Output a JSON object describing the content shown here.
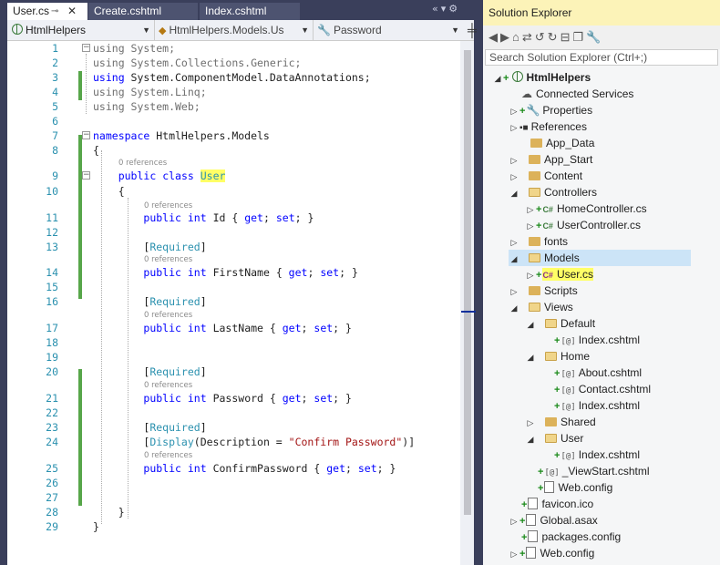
{
  "editor": {
    "tabs": [
      {
        "label": "User.cs",
        "active": true
      },
      {
        "label": "Create.cshtml",
        "active": false
      },
      {
        "label": "Index.cshtml",
        "active": false
      }
    ],
    "navbar": {
      "project": "HtmlHelpers",
      "type": "HtmlHelpers.Models.Us",
      "member": "Password"
    },
    "references_label": "0 references"
  },
  "solution_explorer": {
    "title": "Solution Explorer",
    "search_placeholder": "Search Solution Explorer (Ctrl+;)",
    "nodes": [
      {
        "label": "HtmlHelpers",
        "icon": "project-icon"
      },
      {
        "label": "Connected Services",
        "icon": "connected-services-icon"
      },
      {
        "label": "Properties",
        "icon": "wrench-icon"
      },
      {
        "label": "References",
        "icon": "references-icon"
      },
      {
        "label": "App_Data",
        "icon": "folder-icon"
      },
      {
        "label": "App_Start",
        "icon": "folder-icon"
      },
      {
        "label": "Content",
        "icon": "folder-icon"
      },
      {
        "label": "Controllers",
        "icon": "folder-open-icon"
      },
      {
        "label": "HomeController.cs",
        "icon": "csharp-file-icon"
      },
      {
        "label": "UserController.cs",
        "icon": "csharp-file-icon"
      },
      {
        "label": "fonts",
        "icon": "folder-icon"
      },
      {
        "label": "Models",
        "icon": "folder-open-icon"
      },
      {
        "label": "User.cs",
        "icon": "csharp-file-icon"
      },
      {
        "label": "Scripts",
        "icon": "folder-icon"
      },
      {
        "label": "Views",
        "icon": "folder-open-icon"
      },
      {
        "label": "Default",
        "icon": "folder-open-icon"
      },
      {
        "label": "Index.cshtml",
        "icon": "razor-file-icon"
      },
      {
        "label": "Home",
        "icon": "folder-open-icon"
      },
      {
        "label": "About.cshtml",
        "icon": "razor-file-icon"
      },
      {
        "label": "Contact.cshtml",
        "icon": "razor-file-icon"
      },
      {
        "label": "Index.cshtml",
        "icon": "razor-file-icon"
      },
      {
        "label": "Shared",
        "icon": "folder-icon"
      },
      {
        "label": "User",
        "icon": "folder-open-icon"
      },
      {
        "label": "Index.cshtml",
        "icon": "razor-file-icon"
      },
      {
        "label": "_ViewStart.cshtml",
        "icon": "razor-file-icon"
      },
      {
        "label": "Web.config",
        "icon": "config-file-icon"
      },
      {
        "label": "favicon.ico",
        "icon": "image-file-icon"
      },
      {
        "label": "Global.asax",
        "icon": "asax-file-icon"
      },
      {
        "label": "packages.config",
        "icon": "config-file-icon"
      },
      {
        "label": "Web.config",
        "icon": "config-file-icon"
      }
    ]
  }
}
